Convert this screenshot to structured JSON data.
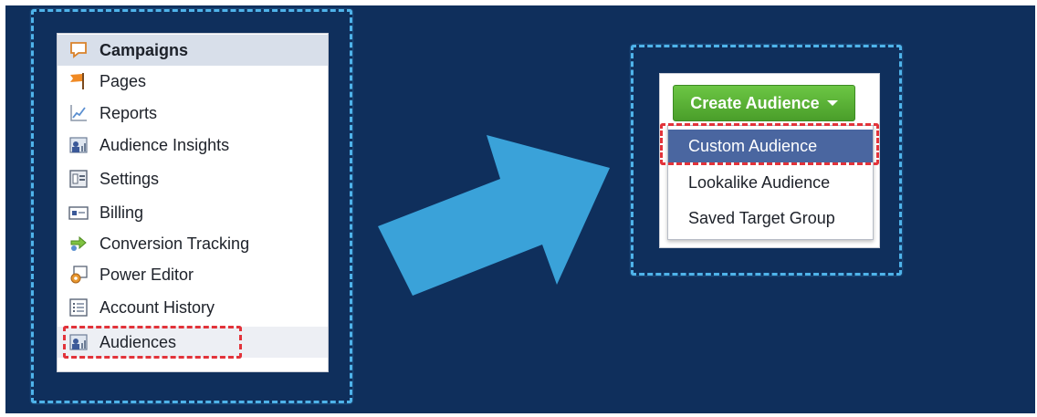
{
  "left_menu": {
    "items": [
      {
        "label": "Campaigns",
        "icon": "campaigns-icon"
      },
      {
        "label": "Pages",
        "icon": "pages-flag-icon"
      },
      {
        "label": "Reports",
        "icon": "reports-chart-icon"
      },
      {
        "label": "Audience Insights",
        "icon": "audience-insights-icon"
      },
      {
        "label": "Settings",
        "icon": "settings-icon"
      },
      {
        "label": "Billing",
        "icon": "billing-card-icon"
      },
      {
        "label": "Conversion Tracking",
        "icon": "conversion-tracking-icon"
      },
      {
        "label": "Power Editor",
        "icon": "power-editor-icon"
      },
      {
        "label": "Account History",
        "icon": "account-history-icon"
      },
      {
        "label": "Audiences",
        "icon": "audiences-icon"
      }
    ]
  },
  "create_audience": {
    "button_label": "Create Audience",
    "options": [
      {
        "label": "Custom Audience"
      },
      {
        "label": "Lookalike Audience"
      },
      {
        "label": "Saved Target Group"
      }
    ]
  },
  "colors": {
    "background": "#0f2f5c",
    "frame": "#4fb3ea",
    "arrow": "#3aa2d9",
    "highlight": "#e2333a",
    "button_green": "#5bb135",
    "selected_blue": "#4a66a0"
  }
}
